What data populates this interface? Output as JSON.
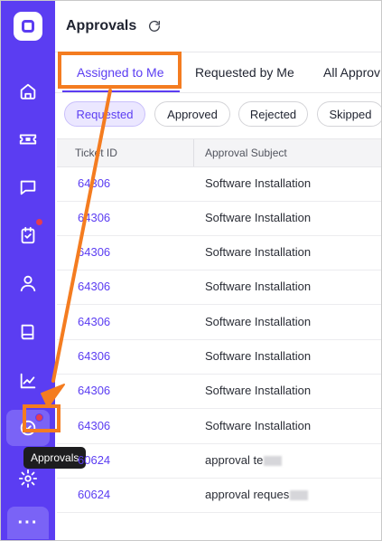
{
  "header": {
    "title": "Approvals"
  },
  "tabs": [
    {
      "label": "Assigned to Me",
      "active": true
    },
    {
      "label": "Requested by Me",
      "active": false
    },
    {
      "label": "All Approv",
      "active": false
    }
  ],
  "filters": [
    {
      "label": "Requested",
      "active": true
    },
    {
      "label": "Approved",
      "active": false
    },
    {
      "label": "Rejected",
      "active": false
    },
    {
      "label": "Skipped",
      "active": false
    }
  ],
  "table": {
    "columns": [
      "Ticket ID",
      "Approval Subject"
    ],
    "rows": [
      {
        "id": "64306",
        "subject": "Software Installation"
      },
      {
        "id": "64306",
        "subject": "Software Installation"
      },
      {
        "id": "64306",
        "subject": "Software Installation"
      },
      {
        "id": "64306",
        "subject": "Software Installation"
      },
      {
        "id": "64306",
        "subject": "Software Installation"
      },
      {
        "id": "64306",
        "subject": "Software Installation"
      },
      {
        "id": "64306",
        "subject": "Software Installation"
      },
      {
        "id": "64306",
        "subject": "Software Installation"
      },
      {
        "id": "60624",
        "subject": "approval te"
      },
      {
        "id": "60624",
        "subject": "approval reques"
      }
    ]
  },
  "sidebar": {
    "tooltip": "Approvals",
    "more_label": "···",
    "items": [
      "home-icon",
      "ticket-icon",
      "chat-icon",
      "approvals-task-icon",
      "user-icon",
      "book-icon",
      "reports-icon",
      "approvals-icon",
      "gear-icon"
    ]
  },
  "colors": {
    "brand": "#5b3df2",
    "annotation": "#f47c20",
    "badge": "#e53d4f"
  }
}
